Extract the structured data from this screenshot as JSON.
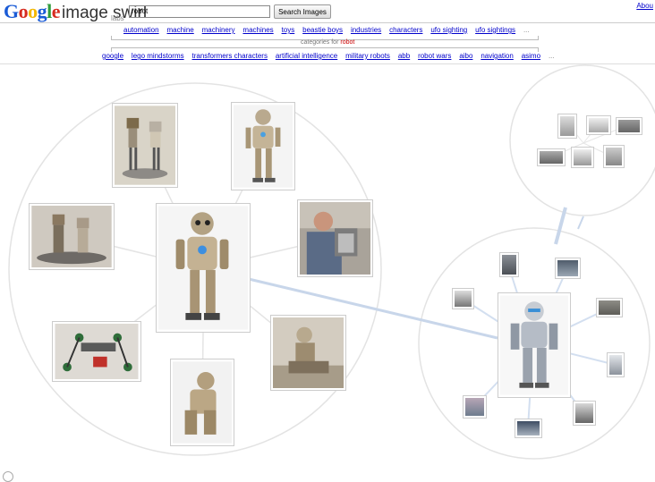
{
  "header": {
    "logo_text": "Google",
    "product_name": "image swirl",
    "labs_label": "labs",
    "search_value": "robot",
    "search_button_label": "Search Images",
    "about_link": "Abou"
  },
  "categories_row1": [
    "automation",
    "machine",
    "machinery",
    "machines",
    "toys",
    "beastie boys",
    "industries",
    "characters",
    "ufo sighting",
    "ufo sightings"
  ],
  "categories_row2": [
    "google",
    "lego mindstorms",
    "transformers characters",
    "artificial intelligence",
    "military robots",
    "abb",
    "robot wars",
    "aibo",
    "navigation",
    "asimo"
  ],
  "more_symbol": "...",
  "category_caption_prefix": "categories for",
  "category_caption_term": "robot",
  "colors": {
    "link": "#0000cc",
    "accent": "#cc0000",
    "connector": "#b9cde8"
  },
  "main_cluster": [
    "robot-figures-thumb",
    "humanoid-robot-thumb",
    "figurine-pair-thumb",
    "center-robot-thumb",
    "man-with-robot-thumb",
    "robot-kit-thumb",
    "seated-robot-thumb",
    "crouching-robot-thumb"
  ],
  "side_cluster": [
    "silver-robot-center-thumb",
    "small-robot-thumbs"
  ],
  "top_cluster": [
    "mini-robot-thumbs"
  ]
}
